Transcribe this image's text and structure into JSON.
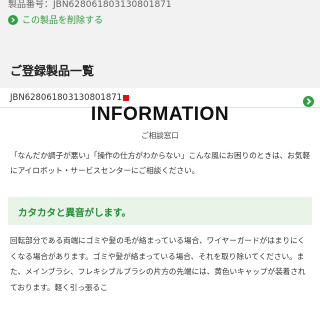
{
  "serial": {
    "text": "製品番号：JBN628061803130801871"
  },
  "delete_link": {
    "label": "この製品を削除する"
  },
  "registered": {
    "title": "ご登録製品一覧"
  },
  "product": {
    "id": "JBN628061803130801871"
  },
  "info": {
    "title": "INFORMATION",
    "subtitle": "ご相談窓口"
  },
  "intro": {
    "text": "「なんだか調子が悪い」「操作の仕方がわからない」こんな風にお困りのときは、お気軽にアイロボット・サービスセンターにご相談ください。"
  },
  "accordion": {
    "title": "カタカタと異音がします。"
  },
  "body": {
    "text": "回転部分である両端にゴミや髪の毛が絡まっている場合、ワイヤーガードがはまりにくくなる場合があります。ゴミや髪が絡まっている場合、それを取り除いてください。また、メインブラシ、フレキシブルブラシの片方の先端には、黄色いキャップが装着されております。軽く引っ張るこ"
  },
  "colors": {
    "accent_green": "#2ea043",
    "band_gray": "#f2f2f2"
  }
}
